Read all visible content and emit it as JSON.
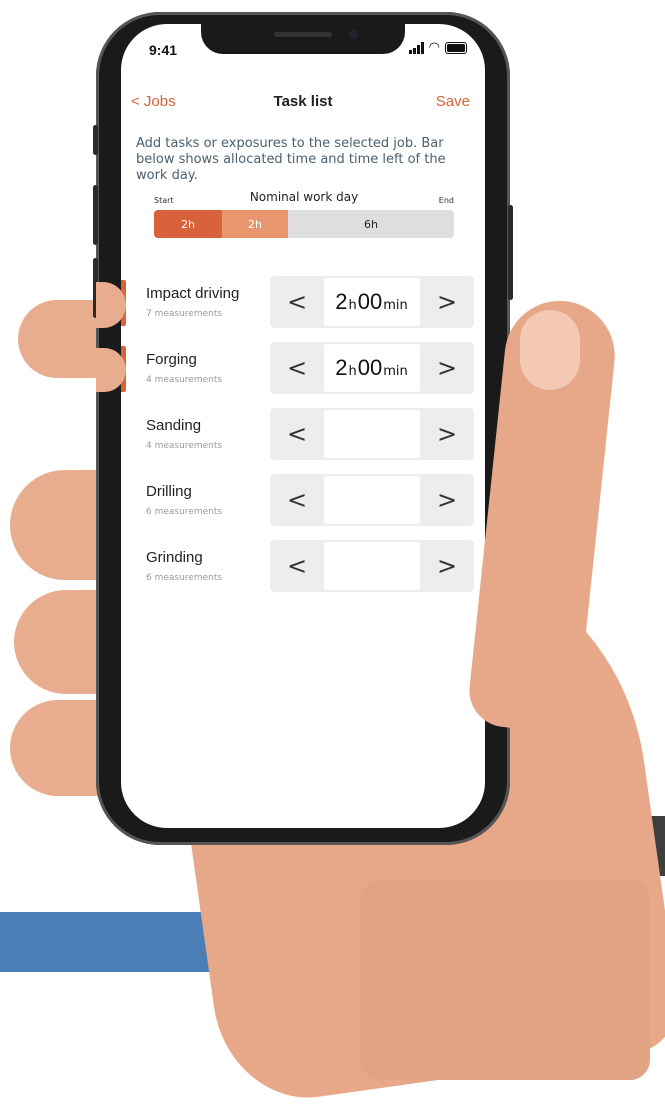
{
  "status": {
    "time": "9:41"
  },
  "nav": {
    "back": "< Jobs",
    "title": "Task list",
    "save": "Save"
  },
  "description": "Add tasks or exposures to the selected job. Bar below shows allocated time and time left of the work day.",
  "workday": {
    "start": "Start",
    "title": "Nominal work day",
    "end": "End",
    "segments": [
      {
        "label": "2h",
        "color": "#d8623a"
      },
      {
        "label": "2h",
        "color": "#e8966f"
      },
      {
        "label": "6h",
        "color": "#dedede"
      }
    ]
  },
  "tasks": [
    {
      "name": "Impact driving",
      "sub": "7 measurements",
      "hours": "2",
      "h_unit": "h",
      "minutes": "00",
      "min_unit": "min",
      "selected": true
    },
    {
      "name": "Forging",
      "sub": "4 measurements",
      "hours": "2",
      "h_unit": "h",
      "minutes": "00",
      "min_unit": "min",
      "selected": true
    },
    {
      "name": "Sanding",
      "sub": "4 measurements",
      "selected": false
    },
    {
      "name": "Drilling",
      "sub": "6 measurements",
      "selected": false
    },
    {
      "name": "Grinding",
      "sub": "6 measurements",
      "selected": false
    }
  ],
  "icons": {
    "left": "chevron-left-icon",
    "right": "chevron-right-icon"
  },
  "colors": {
    "accent": "#d8623a",
    "accent_light": "#e8966f"
  }
}
